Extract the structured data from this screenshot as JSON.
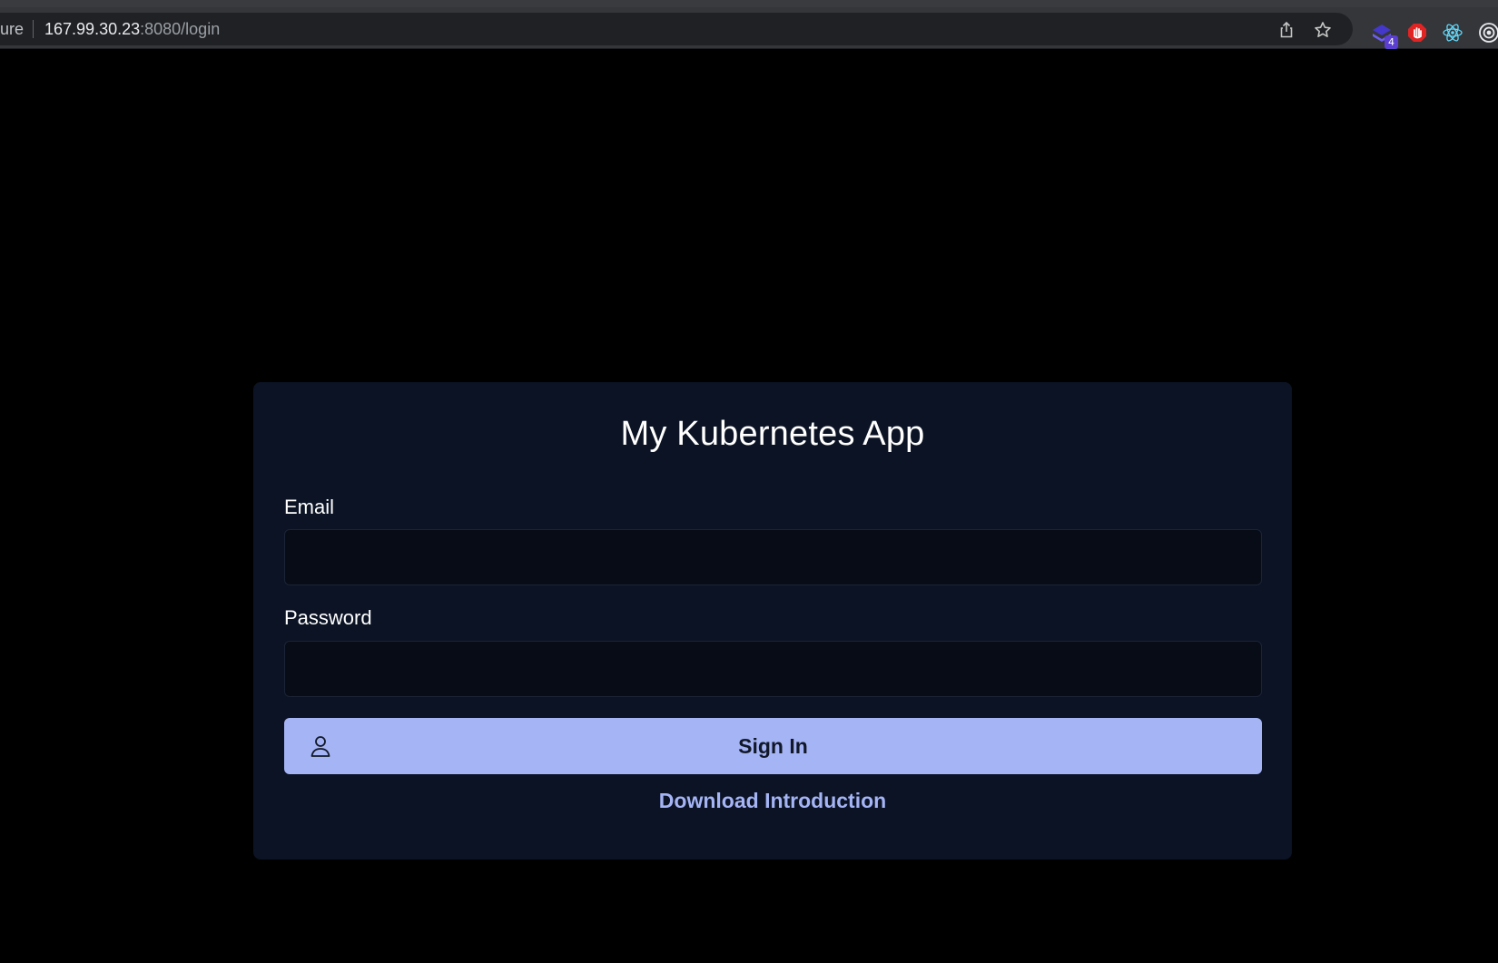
{
  "browser": {
    "security_text": "ure",
    "url_host": "167.99.30.23",
    "url_rest": ":8080/login",
    "icons": [
      "share-icon",
      "bookmark-star-icon",
      "extension-stack-icon",
      "extension-adblock-icon",
      "extension-react-devtools-icon",
      "extension-target-icon"
    ],
    "extension_badge": "4"
  },
  "login": {
    "title": "My Kubernetes App",
    "email_label": "Email",
    "email_value": "",
    "password_label": "Password",
    "password_value": "",
    "signin_label": "Sign In",
    "download_label": "Download Introduction"
  },
  "colors": {
    "page_background": "#000000",
    "card_background": "#0b1324",
    "input_background": "#070c17",
    "accent": "#a5b4f5",
    "button_text": "#111827"
  }
}
